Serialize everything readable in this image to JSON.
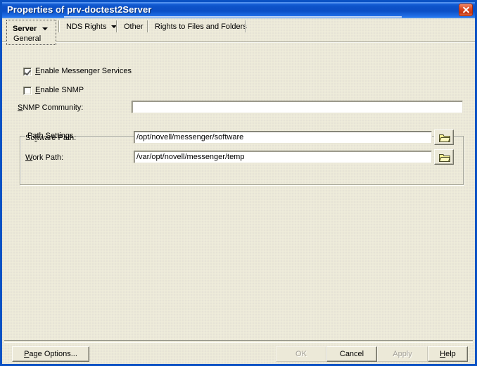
{
  "window": {
    "title": "Properties of prv-doctest2Server",
    "close_icon": "close-x-icon",
    "accent_color": "#0a52c4",
    "titlebar_color": "#0d52c8",
    "close_button_color": "#c33512",
    "client_bg": "#ece9d8"
  },
  "tabs": [
    {
      "label": "Server",
      "sublabel": "General",
      "has_dropdown": true,
      "active": true
    },
    {
      "label": "NDS Rights",
      "has_dropdown": true,
      "active": false
    },
    {
      "label": "Other",
      "has_dropdown": false,
      "active": false
    },
    {
      "label": "Rights to Files and Folders",
      "has_dropdown": false,
      "active": false
    }
  ],
  "form": {
    "enable_messenger": {
      "label_pre": "",
      "label_accel": "E",
      "label_post": "nable Messenger Services",
      "checked": true
    },
    "enable_snmp": {
      "label_pre": "",
      "label_accel": "E",
      "label_post": "nable SNMP",
      "checked": false
    },
    "snmp_community": {
      "label_accel": "S",
      "label_post": "NMP Community:",
      "value": "",
      "placeholder": ""
    },
    "group_path_settings": {
      "title": "Path Settings",
      "software_path": {
        "label_pre": "So",
        "label_accel": "f",
        "label_post": "tware Path:",
        "value": "/opt/novell/messenger/software",
        "browse_icon": "folder-icon"
      },
      "work_path": {
        "label_accel": "W",
        "label_post": "ork Path:",
        "value": "/var/opt/novell/messenger/temp",
        "browse_icon": "folder-icon"
      }
    }
  },
  "buttons": {
    "page_options": {
      "accel": "P",
      "post": "age Options...",
      "enabled": true
    },
    "ok": {
      "label": "OK",
      "enabled": false
    },
    "cancel": {
      "label": "Cancel",
      "enabled": true
    },
    "apply": {
      "label": "Apply",
      "enabled": false
    },
    "help": {
      "accel": "H",
      "post": "elp",
      "enabled": true
    }
  }
}
